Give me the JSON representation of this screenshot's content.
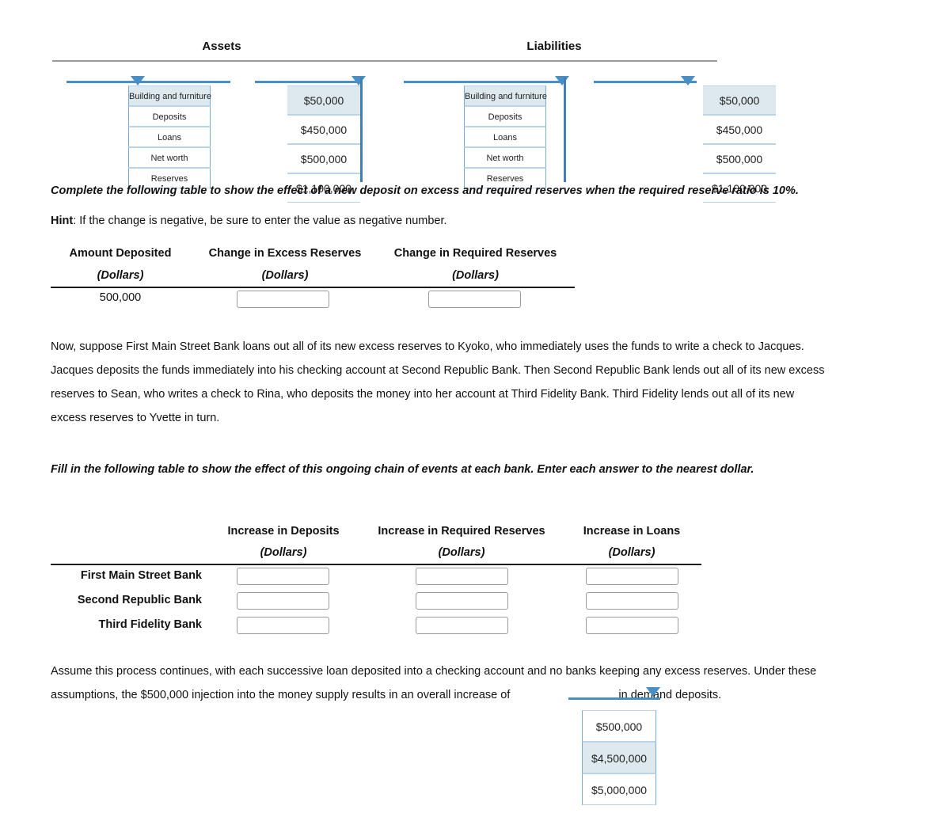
{
  "balance_sheet": {
    "assets_header": "Assets",
    "liabilities_header": "Liabilities",
    "dropdowns": [
      {
        "name": "assets-account-dropdown",
        "kind": "label",
        "selected": "Building and furniture",
        "options": [
          "Building and furniture",
          "Deposits",
          "Loans",
          "Net worth",
          "Reserves"
        ]
      },
      {
        "name": "assets-amount-dropdown",
        "kind": "money",
        "selected": "$50,000",
        "options": [
          "$50,000",
          "$450,000",
          "$500,000",
          "$1,100,000"
        ]
      },
      {
        "name": "liabilities-account-dropdown",
        "kind": "label",
        "selected": "Building and furniture",
        "options": [
          "Building and furniture",
          "Deposits",
          "Loans",
          "Net worth",
          "Reserves"
        ]
      },
      {
        "name": "liabilities-amount-dropdown",
        "kind": "money",
        "selected": "$50,000",
        "options": [
          "$50,000",
          "$450,000",
          "$500,000",
          "$1,100,000"
        ]
      }
    ]
  },
  "instructions": {
    "complete_table": "Complete the following table to show the effect of a new deposit on excess and required reserves when the required reserve ratio is 10%.",
    "hint_label": "Hint",
    "hint_text": ": If the change is negative, be sure to enter the value as negative number."
  },
  "deposit_table": {
    "headers": [
      "Amount Deposited",
      "Change in Excess Reserves",
      "Change in Required Reserves"
    ],
    "subheaders": [
      "(Dollars)",
      "(Dollars)",
      "(Dollars)"
    ],
    "rows": [
      {
        "amount_deposited": "500,000",
        "change_excess_reserves": "",
        "change_required_reserves": ""
      }
    ]
  },
  "narrative": {
    "line1": "Now, suppose First Main Street Bank loans out all of its new excess reserves to Kyoko, who immediately uses the funds to write a check to Jacques.",
    "line2": "Jacques deposits the funds immediately into his checking account at Second Republic Bank. Then Second Republic Bank lends out all of its new excess",
    "line3": "reserves to Sean, who writes a check to Rina, who deposits the money into her account at Third Fidelity Bank. Third Fidelity lends out all of its new",
    "line4": "excess reserves to Yvette in turn.",
    "fill_in": "Fill in the following table to show the effect of this ongoing chain of events at each bank. Enter each answer to the nearest dollar."
  },
  "bank_table": {
    "headers": [
      "Increase in Deposits",
      "Increase in Required Reserves",
      "Increase in Loans"
    ],
    "subheaders": [
      "(Dollars)",
      "(Dollars)",
      "(Dollars)"
    ],
    "rows": [
      {
        "bank": "First Main Street Bank",
        "deposits": "",
        "required_reserves": "",
        "loans": ""
      },
      {
        "bank": "Second Republic Bank",
        "deposits": "",
        "required_reserves": "",
        "loans": ""
      },
      {
        "bank": "Third Fidelity Bank",
        "deposits": "",
        "required_reserves": "",
        "loans": ""
      }
    ]
  },
  "conclusion": {
    "line1": "Assume this process continues, with each successive loan deposited into a checking account and no banks keeping any excess reserves. Under these",
    "line2_before": "assumptions, the $500,000 injection into the money supply results in an overall increase of",
    "line2_after": "in demand deposits.",
    "dropdown": {
      "name": "overall-increase-dropdown",
      "selected": "$4,500,000",
      "options": [
        "$500,000",
        "$4,500,000",
        "$5,000,000"
      ]
    }
  },
  "colors": {
    "accent_blue": "#4a8fc4",
    "stem_blue": "#3f7fb5",
    "option_border": "#b9d3e8",
    "selected_bg": "#dee8ef",
    "rule_gray": "#9a9a9a",
    "text": "#111111"
  }
}
